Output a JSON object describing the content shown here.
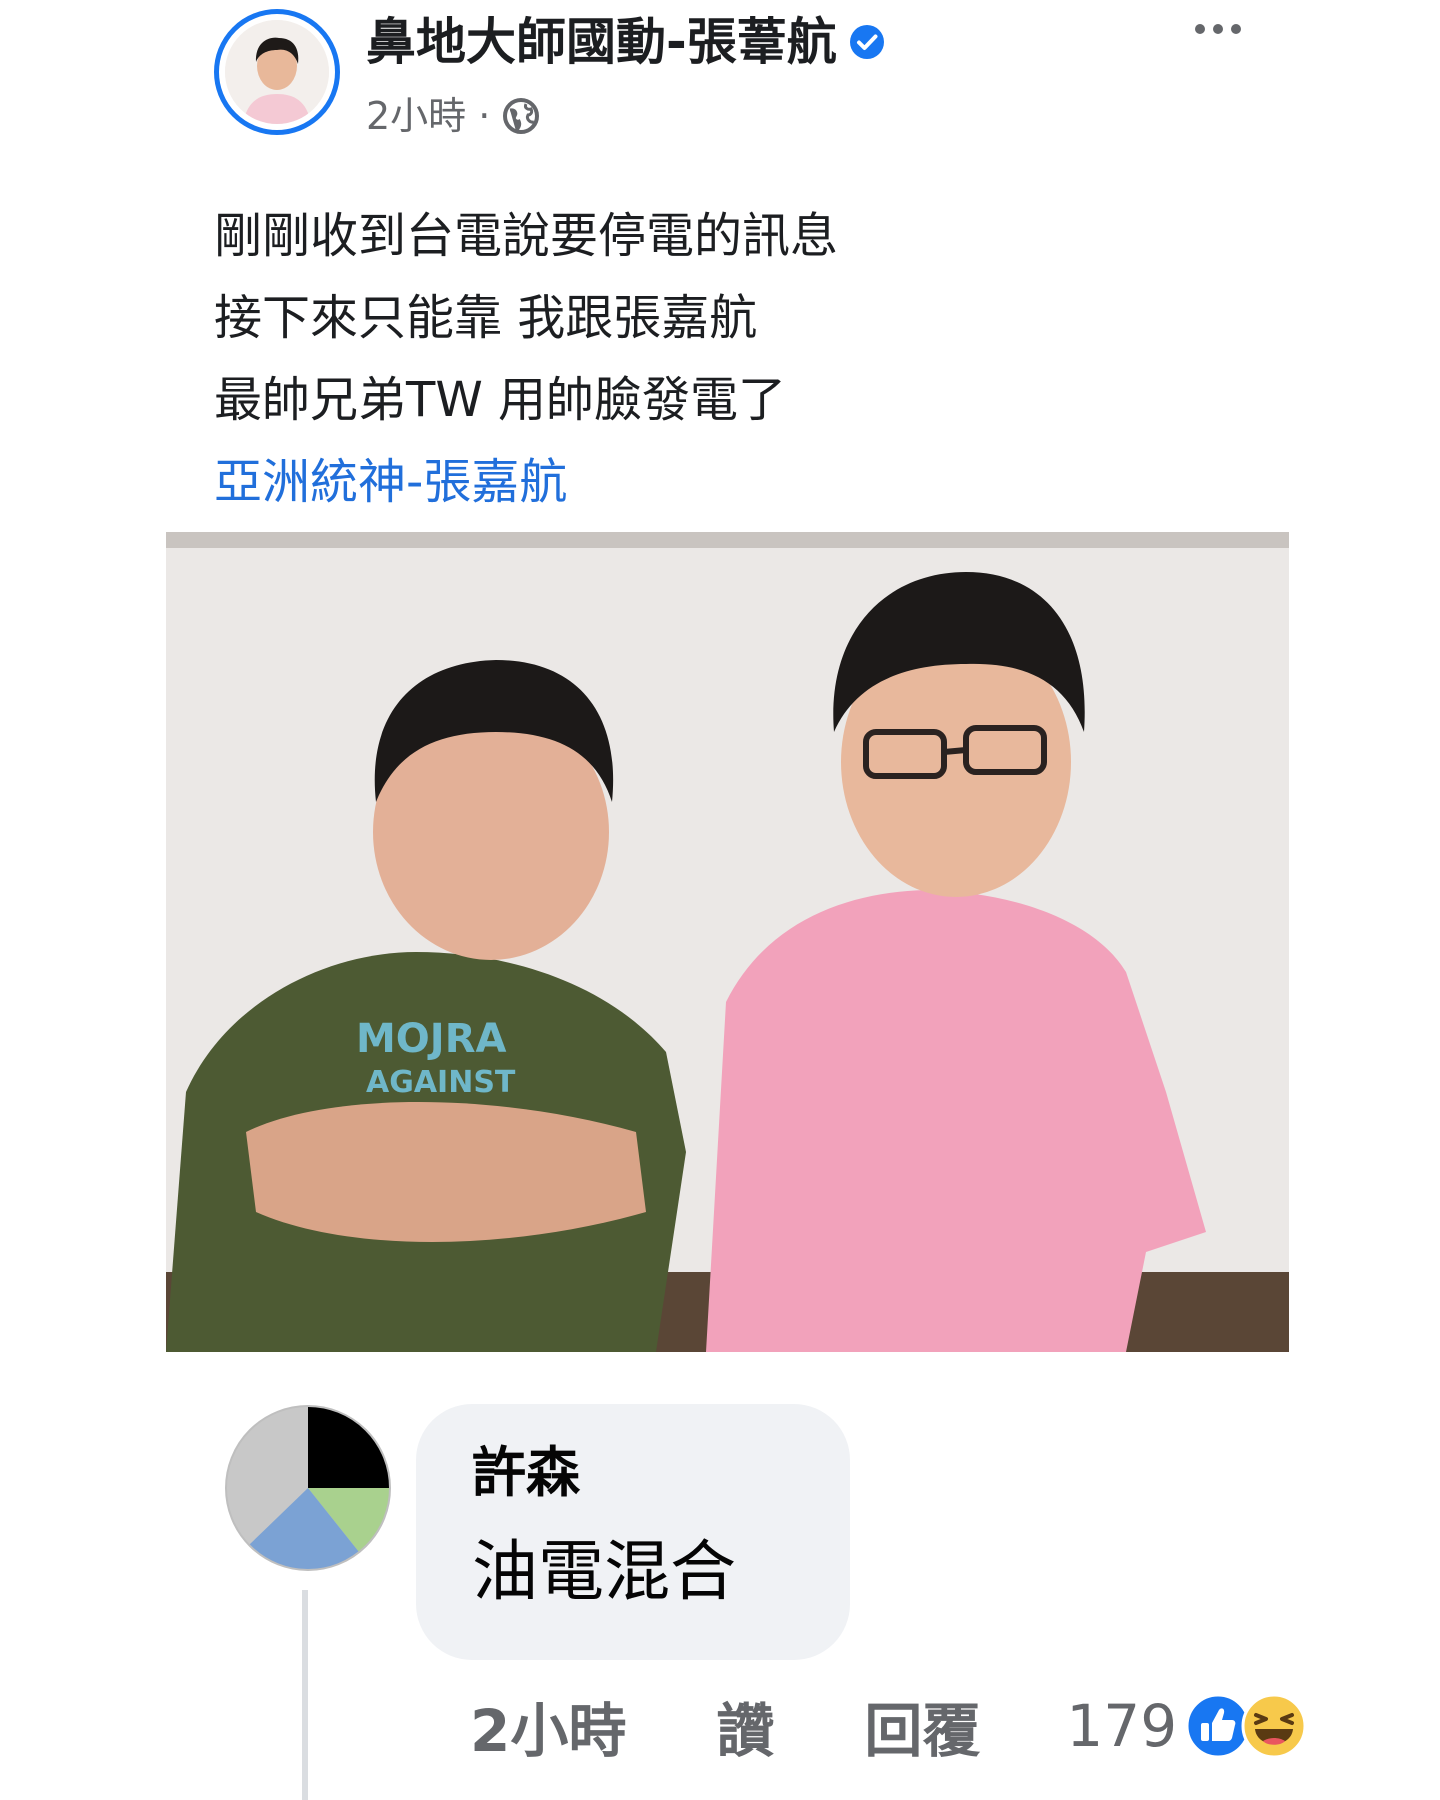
{
  "post": {
    "author": "鼻地大師國動-張葦航",
    "timestamp": "2小時",
    "separator": "·",
    "privacy_icon": "globe-icon",
    "verified_icon": "verified-badge-icon",
    "menu_icon": "more-options-icon",
    "lines": [
      "剛剛收到台電說要停電的訊息",
      "接下來只能靠 我跟張嘉航",
      "最帥兄弟TW  用帥臉發電了"
    ],
    "tag_link": "亞洲統神-張嘉航"
  },
  "comment": {
    "author": "許森",
    "text": "油電混合",
    "timestamp": "2小時",
    "like_label": "讚",
    "reply_label": "回覆",
    "reaction_count": "179",
    "reactions": [
      "like-reaction-icon",
      "haha-reaction-icon"
    ]
  },
  "colors": {
    "accent": "#1877f2",
    "link": "#216fdb",
    "meta": "#65676b",
    "bubble": "#f0f2f5"
  }
}
